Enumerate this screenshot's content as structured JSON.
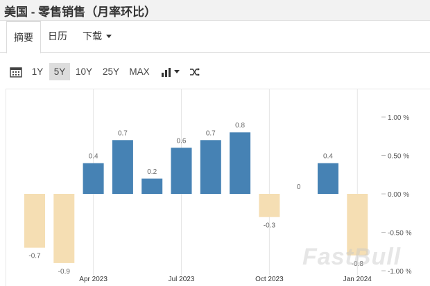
{
  "page": {
    "title": "美国 - 零售销售（月率环比）"
  },
  "tabs": [
    {
      "label": "摘要",
      "active": true
    },
    {
      "label": "日历",
      "active": false
    },
    {
      "label": "下载",
      "active": false
    }
  ],
  "toolbar": {
    "ranges": [
      "1Y",
      "5Y",
      "10Y",
      "25Y",
      "MAX"
    ],
    "selected_range": "5Y",
    "calendar_icon": "calendar-icon",
    "chart_type_icon": "bar-chart-icon",
    "compare_icon": "shuffle-icon"
  },
  "watermark": "FastBull",
  "colors": {
    "positive": "#4682b4",
    "negative": "#f5deb3",
    "label": "#666666",
    "grid": "#e6e6e6"
  },
  "chart_data": {
    "type": "bar",
    "x": [
      "2023-02",
      "2023-03",
      "2023-04",
      "2023-05",
      "2023-06",
      "2023-07",
      "2023-08",
      "2023-09",
      "2023-10",
      "2023-11",
      "2023-12",
      "2024-01"
    ],
    "values": [
      -0.7,
      -0.9,
      0.4,
      0.7,
      0.2,
      0.6,
      0.7,
      0.8,
      -0.3,
      0,
      0.4,
      -0.8
    ],
    "value_labels": [
      "-0.7",
      "-0.9",
      "0.4",
      "0.7",
      "0.2",
      "0.6",
      "0.7",
      "0.8",
      "-0.3",
      "0",
      "0.4",
      "-0.8"
    ],
    "x_ticks": [
      {
        "at": "2023-04",
        "label": "Apr 2023"
      },
      {
        "at": "2023-07",
        "label": "Jul 2023"
      },
      {
        "at": "2023-10",
        "label": "Oct 2023"
      },
      {
        "at": "2024-01",
        "label": "Jan 2024"
      }
    ],
    "y_ticks": [
      1.0,
      0.5,
      0.0,
      -0.5,
      -1.0
    ],
    "y_tick_labels": [
      "1.00 %",
      "0.50 %",
      "0.00 %",
      "-0.50 %",
      "-1.00 %"
    ],
    "ylim": [
      -1.0,
      1.0
    ],
    "y_axis_position": "right",
    "grid": "vertical at x ticks"
  }
}
